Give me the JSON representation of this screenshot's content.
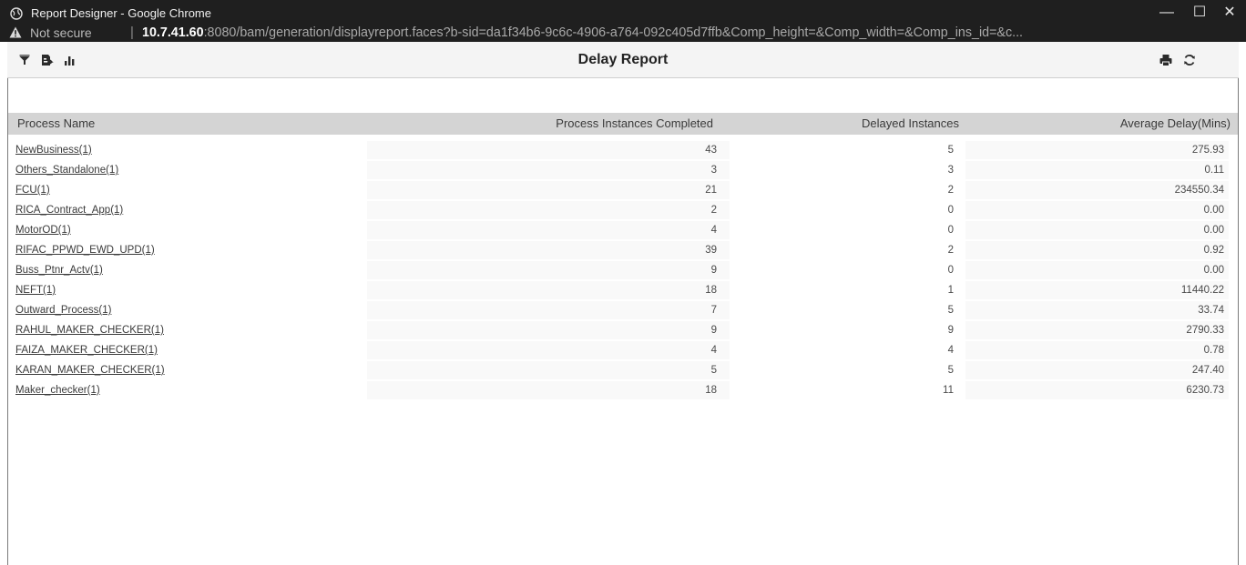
{
  "window": {
    "title": "Report Designer - Google Chrome",
    "controls": {
      "minimize": "—",
      "maximize": "☐",
      "close": "✕"
    }
  },
  "address_bar": {
    "security": "Not secure",
    "separator": "|",
    "host": "10.7.41.60",
    "rest": ":8080/bam/generation/displayreport.faces?b-sid=da1f34b6-9c6c-4906-a764-092c405d7ffb&Comp_height=&Comp_width=&Comp_ins_id=&c..."
  },
  "toolbar": {
    "left_icons": [
      "filter-icon",
      "export-icon",
      "bar-chart-icon"
    ],
    "right_icons": [
      "print-icon",
      "refresh-icon"
    ]
  },
  "report": {
    "title": "Delay Report",
    "columns": {
      "name": "Process Name",
      "completed": "Process Instances Completed",
      "delayed": "Delayed Instances",
      "avg": "Average Delay(Mins)"
    },
    "rows": [
      {
        "name": "NewBusiness(1)",
        "completed": "43",
        "delayed": "5",
        "avg": "275.93"
      },
      {
        "name": "Others_Standalone(1)",
        "completed": "3",
        "delayed": "3",
        "avg": "0.11"
      },
      {
        "name": "FCU(1)",
        "completed": "21",
        "delayed": "2",
        "avg": "234550.34"
      },
      {
        "name": "RICA_Contract_App(1)",
        "completed": "2",
        "delayed": "0",
        "avg": "0.00"
      },
      {
        "name": "MotorOD(1)",
        "completed": "4",
        "delayed": "0",
        "avg": "0.00"
      },
      {
        "name": "RIFAC_PPWD_EWD_UPD(1)",
        "completed": "39",
        "delayed": "2",
        "avg": "0.92"
      },
      {
        "name": "Buss_Ptnr_Actv(1)",
        "completed": "9",
        "delayed": "0",
        "avg": "0.00"
      },
      {
        "name": "NEFT(1)",
        "completed": "18",
        "delayed": "1",
        "avg": "11440.22"
      },
      {
        "name": "Outward_Process(1)",
        "completed": "7",
        "delayed": "5",
        "avg": "33.74"
      },
      {
        "name": "RAHUL_MAKER_CHECKER(1)",
        "completed": "9",
        "delayed": "9",
        "avg": "2790.33"
      },
      {
        "name": "FAIZA_MAKER_CHECKER(1)",
        "completed": "4",
        "delayed": "4",
        "avg": "0.78"
      },
      {
        "name": "KARAN_MAKER_CHECKER(1)",
        "completed": "5",
        "delayed": "5",
        "avg": "247.40"
      },
      {
        "name": "Maker_checker(1)",
        "completed": "18",
        "delayed": "11",
        "avg": "6230.73"
      }
    ]
  }
}
